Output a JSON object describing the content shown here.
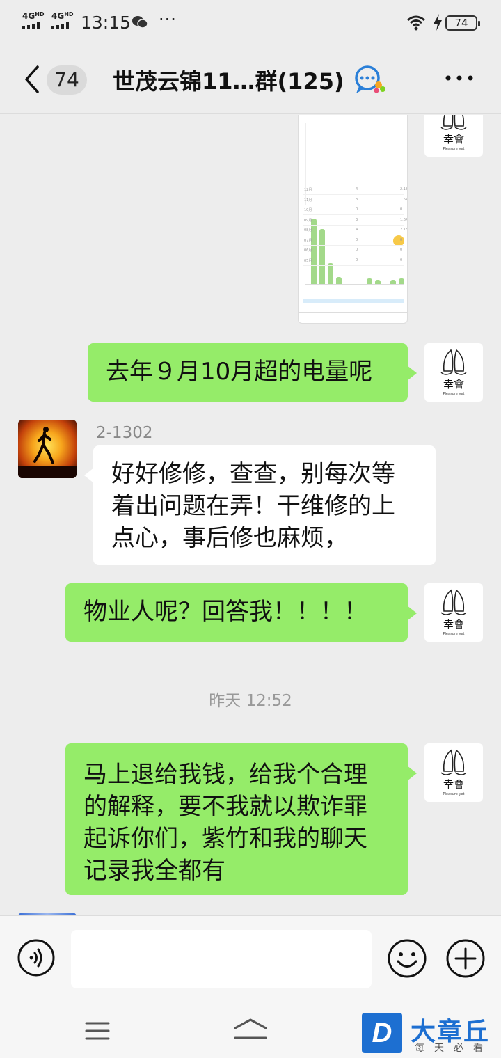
{
  "status_bar": {
    "signal_1": "4G",
    "signal_1_sup": "HD",
    "signal_2": "4G",
    "signal_2_sup": "HD",
    "time": "13:15",
    "dots": "···",
    "battery": "74"
  },
  "header": {
    "unread_count": "74",
    "title": "世茂云锦11…群(125)"
  },
  "messages": [
    {
      "type": "image",
      "sender": "self",
      "image_rows": [
        {
          "c1": "12月",
          "c2": "4",
          "c3": "2.18"
        },
        {
          "c1": "11月",
          "c2": "3",
          "c3": "1.64"
        },
        {
          "c1": "10月",
          "c2": "0",
          "c3": "0"
        },
        {
          "c1": "09月",
          "c2": "3",
          "c3": "1.64"
        },
        {
          "c1": "08月",
          "c2": "4",
          "c3": "2.18"
        },
        {
          "c1": "07月",
          "c2": "0",
          "c3": "0"
        },
        {
          "c1": "06月",
          "c2": "0",
          "c3": "0"
        },
        {
          "c1": "05月",
          "c2": "0",
          "c3": "0"
        }
      ]
    },
    {
      "type": "text",
      "sender": "self",
      "text": "去年９月10月超的电量呢"
    },
    {
      "type": "text",
      "sender": "other",
      "name": "2-1302",
      "text": "好好修修，查查，别每次等着出问题在弄！干维修的上点心，事后修也麻烦，"
    },
    {
      "type": "text",
      "sender": "self",
      "text": "物业人呢？回答我！！！！"
    },
    {
      "type": "timestamp",
      "text": "昨天 12:52"
    },
    {
      "type": "text",
      "sender": "self",
      "text": "马上退给我钱，给我个合理的解释，要不我就以欺诈罪起诉你们，紫竹和我的聊天记录我全都有"
    }
  ],
  "self_avatar": {
    "caption": "幸會",
    "sub": "Pleasure yet"
  },
  "input": {
    "placeholder": ""
  },
  "watermark": {
    "badge": "D",
    "title": "大章丘",
    "subtitle": "每天必看"
  },
  "colors": {
    "bubble_self": "#95ec69",
    "bubble_other": "#ffffff",
    "background": "#ededed",
    "watermark": "#1d6fd1"
  },
  "icons": [
    "back-icon",
    "group-chat-icon",
    "more-icon",
    "voice-icon",
    "emoji-icon",
    "plus-icon",
    "menu-icon",
    "home-icon",
    "wifi-icon",
    "battery-icon"
  ]
}
